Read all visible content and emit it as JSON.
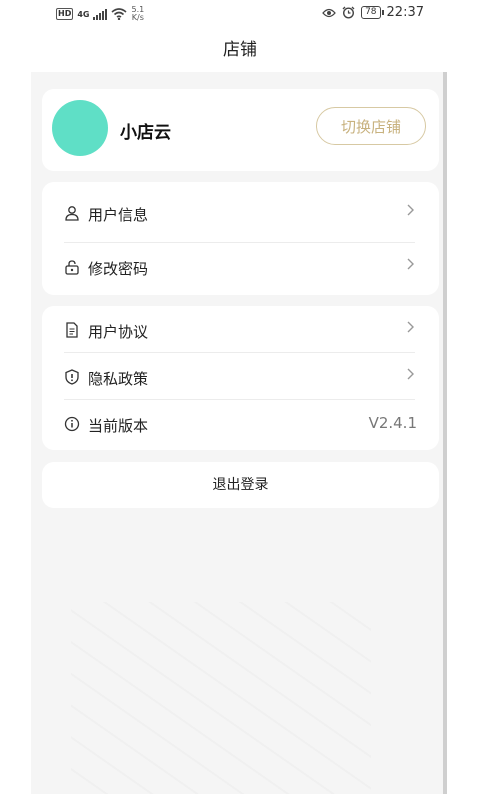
{
  "status": {
    "network": "4G",
    "speed_top": "5.1",
    "speed_bottom": "K/s",
    "battery": "78",
    "time": "22:37"
  },
  "header": {
    "title": "店铺"
  },
  "profile": {
    "name": "小店云",
    "switch_label": "切换店铺",
    "avatar_color": "#5fdfc6"
  },
  "account": {
    "items": [
      {
        "label": "用户信息",
        "icon": "user-icon"
      },
      {
        "label": "修改密码",
        "icon": "lock-icon"
      }
    ]
  },
  "about": {
    "items": [
      {
        "label": "用户协议",
        "icon": "document-icon"
      },
      {
        "label": "隐私政策",
        "icon": "shield-icon"
      },
      {
        "label": "当前版本",
        "icon": "info-icon",
        "value": "V2.4.1"
      }
    ]
  },
  "logout_label": "退出登录",
  "colors": {
    "accent_gold": "#c8b27f",
    "background": "#f5f5f5"
  }
}
